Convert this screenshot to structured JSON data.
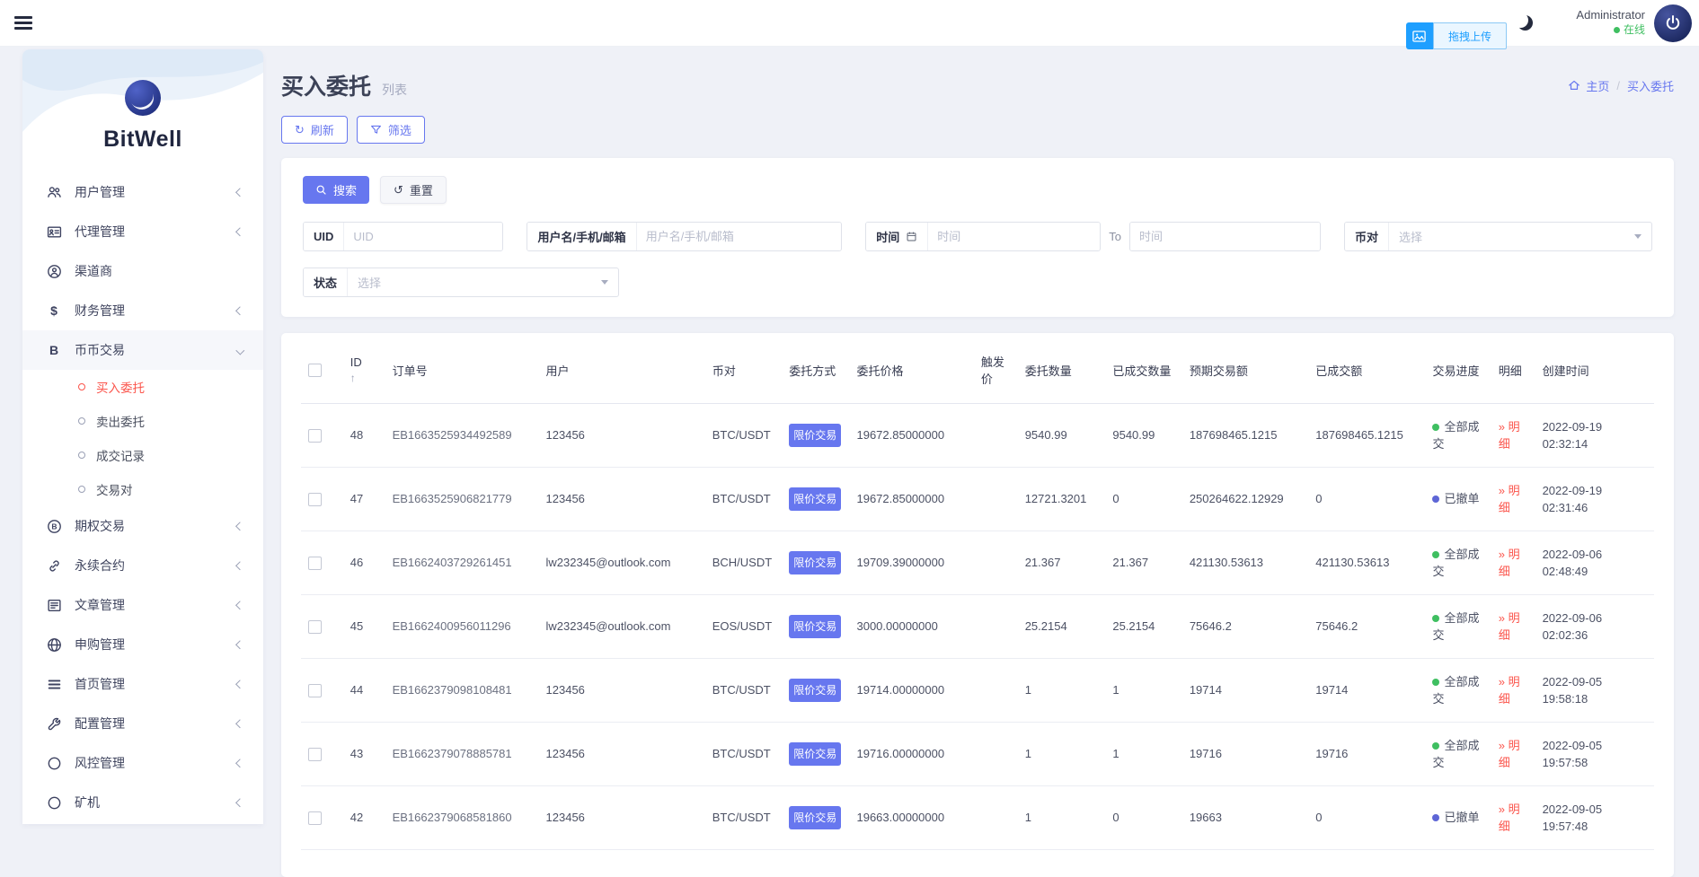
{
  "icons": {
    "refresh": "↻",
    "reset": "↺",
    "sort_up": "↑",
    "dollar": "$",
    "letter_b": "B"
  },
  "topbar": {
    "user_name": "Administrator",
    "user_status": "在线",
    "upload_label": "拖拽上传"
  },
  "sidebar": {
    "brand": "BitWell",
    "items": [
      {
        "label": "用户管理"
      },
      {
        "label": "代理管理"
      },
      {
        "label": "渠道商"
      },
      {
        "label": "财务管理"
      },
      {
        "label": "币币交易",
        "children": [
          {
            "label": "买入委托"
          },
          {
            "label": "卖出委托"
          },
          {
            "label": "成交记录"
          },
          {
            "label": "交易对"
          }
        ]
      },
      {
        "label": "期权交易"
      },
      {
        "label": "永续合约"
      },
      {
        "label": "文章管理"
      },
      {
        "label": "申购管理"
      },
      {
        "label": "首页管理"
      },
      {
        "label": "配置管理"
      },
      {
        "label": "风控管理"
      },
      {
        "label": "矿机"
      }
    ]
  },
  "page": {
    "title": "买入委托",
    "subtitle": "列表",
    "breadcrumb_home": "主页",
    "breadcrumb_sep": "/",
    "breadcrumb_current": "买入委托",
    "refresh_label": "刷新",
    "filter_label": "筛选"
  },
  "search": {
    "search_btn": "搜索",
    "reset_btn": "重置",
    "uid_label": "UID",
    "uid_placeholder": "UID",
    "user_label": "用户名/手机/邮箱",
    "user_placeholder": "用户名/手机/邮箱",
    "time_label": "时间",
    "time_placeholder": "时间",
    "to_label": "To",
    "pair_label": "币对",
    "pair_placeholder": "选择",
    "status_label": "状态",
    "status_placeholder": "选择"
  },
  "table": {
    "headers": [
      "ID",
      "订单号",
      "用户",
      "币对",
      "委托方式",
      "委托价格",
      "触发价",
      "委托数量",
      "已成交数量",
      "预期交易额",
      "已成交额",
      "交易进度",
      "明细",
      "创建时间"
    ],
    "detail_label": "» 明细",
    "rows": [
      {
        "id": "48",
        "order_no": "EB1663525934492589",
        "user": "123456",
        "pair": "BTC/USDT",
        "type": "限价交易",
        "price": "19672.85000000",
        "trigger": "",
        "amount": "9540.99",
        "filled": "9540.99",
        "expected": "187698465.1215",
        "filled_value": "187698465.1215",
        "status": "全部成交",
        "status_type": "success",
        "created": "2022-09-19 02:32:14"
      },
      {
        "id": "47",
        "order_no": "EB1663525906821779",
        "user": "123456",
        "pair": "BTC/USDT",
        "type": "限价交易",
        "price": "19672.85000000",
        "trigger": "",
        "amount": "12721.3201",
        "filled": "0",
        "expected": "250264622.12929",
        "filled_value": "0",
        "status": "已撤单",
        "status_type": "cancel",
        "created": "2022-09-19 02:31:46"
      },
      {
        "id": "46",
        "order_no": "EB1662403729261451",
        "user": "lw232345@outlook.com",
        "pair": "BCH/USDT",
        "type": "限价交易",
        "price": "19709.39000000",
        "trigger": "",
        "amount": "21.367",
        "filled": "21.367",
        "expected": "421130.53613",
        "filled_value": "421130.53613",
        "status": "全部成交",
        "status_type": "success",
        "created": "2022-09-06 02:48:49"
      },
      {
        "id": "45",
        "order_no": "EB1662400956011296",
        "user": "lw232345@outlook.com",
        "pair": "EOS/USDT",
        "type": "限价交易",
        "price": "3000.00000000",
        "trigger": "",
        "amount": "25.2154",
        "filled": "25.2154",
        "expected": "75646.2",
        "filled_value": "75646.2",
        "status": "全部成交",
        "status_type": "success",
        "created": "2022-09-06 02:02:36"
      },
      {
        "id": "44",
        "order_no": "EB1662379098108481",
        "user": "123456",
        "pair": "BTC/USDT",
        "type": "限价交易",
        "price": "19714.00000000",
        "trigger": "",
        "amount": "1",
        "filled": "1",
        "expected": "19714",
        "filled_value": "19714",
        "status": "全部成交",
        "status_type": "success",
        "created": "2022-09-05 19:58:18"
      },
      {
        "id": "43",
        "order_no": "EB1662379078885781",
        "user": "123456",
        "pair": "BTC/USDT",
        "type": "限价交易",
        "price": "19716.00000000",
        "trigger": "",
        "amount": "1",
        "filled": "1",
        "expected": "19716",
        "filled_value": "19716",
        "status": "全部成交",
        "status_type": "success",
        "created": "2022-09-05 19:57:58"
      },
      {
        "id": "42",
        "order_no": "EB1662379068581860",
        "user": "123456",
        "pair": "BTC/USDT",
        "type": "限价交易",
        "price": "19663.00000000",
        "trigger": "",
        "amount": "1",
        "filled": "0",
        "expected": "19663",
        "filled_value": "0",
        "status": "已撤单",
        "status_type": "cancel",
        "created": "2022-09-05 19:57:48"
      }
    ]
  },
  "colors": {
    "primary": "#6777ef",
    "danger": "#fb544b",
    "success": "#3fbf61",
    "cancel_dot": "#5e66d6",
    "upload_blue": "#1e9fff"
  }
}
